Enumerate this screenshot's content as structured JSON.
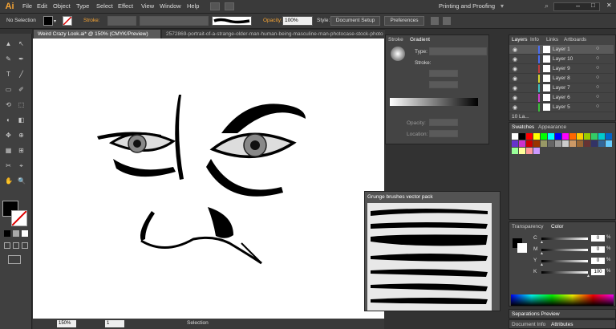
{
  "app": {
    "logo": "Ai"
  },
  "menu": [
    "File",
    "Edit",
    "Object",
    "Type",
    "Select",
    "Effect",
    "View",
    "Window",
    "Help"
  ],
  "workspace": "Printing and Proofing",
  "control": {
    "selection": "No Selection",
    "stroke_label": "Stroke:",
    "opacity_label": "Opacity:",
    "opacity_value": "100%",
    "style_label": "Style:",
    "doc_setup": "Document Setup",
    "preferences": "Preferences"
  },
  "doc_tabs": [
    {
      "label": "Weird Crazy Look.ai* @ 150% (CMYK/Preview)"
    },
    {
      "label": "2572869-portrait-of-a-strange-older-man-human-being-masculine-man-photocase-stock-photo"
    }
  ],
  "stroke_gradient": {
    "tabs": [
      "Stroke",
      "Gradient"
    ],
    "type_label": "Type:",
    "stroke_label": "Stroke:",
    "opacity_label": "Opacity:",
    "location_label": "Location:"
  },
  "layers_panel": {
    "tabs": [
      "Layers",
      "Info",
      "Links",
      "Artboards"
    ],
    "layers": [
      {
        "name": "Layer 1",
        "color": "#4a6cf0"
      },
      {
        "name": "Layer 10",
        "color": "#4a6cf0"
      },
      {
        "name": "Layer 9",
        "color": "#c23c3c"
      },
      {
        "name": "Layer 8",
        "color": "#d8d830"
      },
      {
        "name": "Layer 7",
        "color": "#3cc0c0"
      },
      {
        "name": "Layer 6",
        "color": "#d040d0"
      },
      {
        "name": "Layer 5",
        "color": "#3cc03c"
      }
    ],
    "footer": "10 La..."
  },
  "swatches_panel": {
    "tabs": [
      "Swatches",
      "Appearance"
    ]
  },
  "brushes_panel": {
    "title": "Grunge brushes vector pack"
  },
  "transparency_panel": {
    "tabs": [
      "Transparency",
      "Color"
    ],
    "channels": [
      {
        "label": "C",
        "value": "0",
        "pct": 0
      },
      {
        "label": "M",
        "value": "0",
        "pct": 0
      },
      {
        "label": "Y",
        "value": "0",
        "pct": 0
      },
      {
        "label": "K",
        "value": "100",
        "pct": 100
      }
    ],
    "pct_sign": "%"
  },
  "bottom_tabs": {
    "separations": "Separations Preview",
    "doc_info": "Document Info",
    "attributes": "Attributes"
  },
  "status": {
    "zoom": "150%",
    "artboard": "1",
    "tool": "Selection"
  }
}
